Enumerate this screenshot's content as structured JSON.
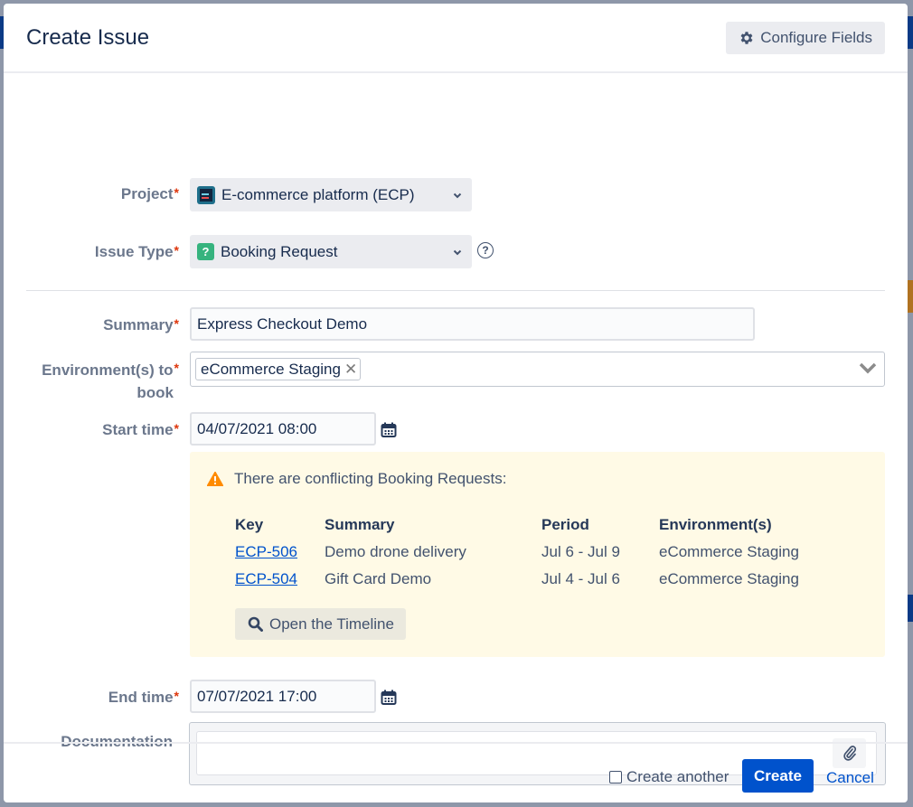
{
  "dialog": {
    "title": "Create Issue",
    "configure_fields_label": "Configure Fields"
  },
  "form": {
    "project": {
      "label": "Project",
      "required_mark": "*",
      "value": "E-commerce platform (ECP)",
      "icon": "project-avatar-icon"
    },
    "issue_type": {
      "label": "Issue Type",
      "required_mark": "*",
      "value": "Booking Request",
      "icon_glyph": "?",
      "help_glyph": "?"
    },
    "summary": {
      "label": "Summary",
      "required_mark": "*",
      "value": "Express Checkout Demo"
    },
    "environments": {
      "label_line1": "Environment(s) to",
      "label_line2": "book",
      "required_mark": "*",
      "selected": [
        "eCommerce Staging"
      ],
      "remove_glyph": "✕"
    },
    "start_time": {
      "label": "Start time",
      "required_mark": "*",
      "value": "04/07/2021 08:00"
    },
    "end_time": {
      "label": "End time",
      "required_mark": "*",
      "value": "07/07/2021 17:00"
    },
    "documentation": {
      "label": "Documentation",
      "value": ""
    }
  },
  "conflicts": {
    "message": "There are conflicting Booking Requests:",
    "columns": [
      "Key",
      "Summary",
      "Period",
      "Environment(s)"
    ],
    "rows": [
      {
        "key": "ECP-506",
        "summary": "Demo drone delivery",
        "period": "Jul 6 - Jul 9",
        "environments": "eCommerce Staging"
      },
      {
        "key": "ECP-504",
        "summary": "Gift Card Demo",
        "period": "Jul 4 - Jul 6",
        "environments": "eCommerce Staging"
      }
    ],
    "timeline_button_label": "Open the Timeline"
  },
  "footer": {
    "create_another_label": "Create another",
    "create_another_checked": false,
    "create_label": "Create",
    "cancel_label": "Cancel"
  },
  "colors": {
    "primary": "#0052cc",
    "required": "#de350b",
    "warning_bg": "#fffae6",
    "warning_icon": "#ff8b00",
    "issue_type_icon": "#36b37e"
  }
}
